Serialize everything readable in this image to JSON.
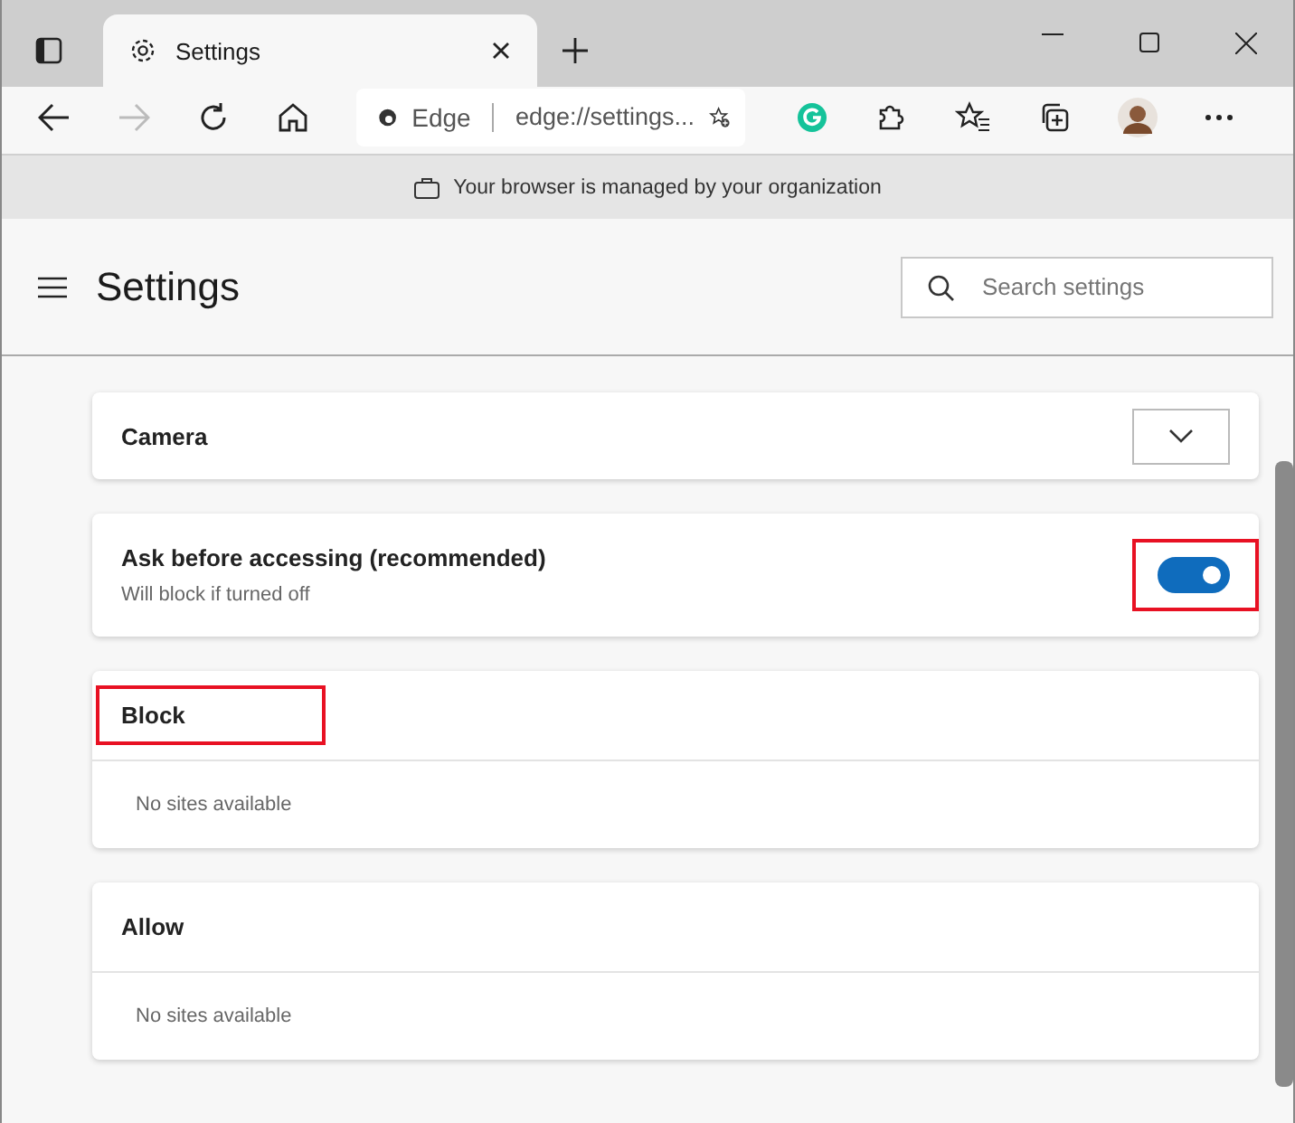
{
  "tab": {
    "title": "Settings",
    "selected": true
  },
  "address_bar": {
    "site_label": "Edge",
    "url": "edge://settings..."
  },
  "managed_notice": "Your browser is managed by your organization",
  "header": {
    "title": "Settings",
    "search": {
      "placeholder": "Search settings"
    }
  },
  "camera": {
    "label": "Camera"
  },
  "ask_setting": {
    "title": "Ask before accessing (recommended)",
    "subtitle": "Will block if turned off",
    "on": true,
    "highlighted": true
  },
  "sections": [
    {
      "title": "Block",
      "empty_text": "No sites available",
      "highlighted": true
    },
    {
      "title": "Allow",
      "empty_text": "No sites available",
      "highlighted": false
    }
  ]
}
